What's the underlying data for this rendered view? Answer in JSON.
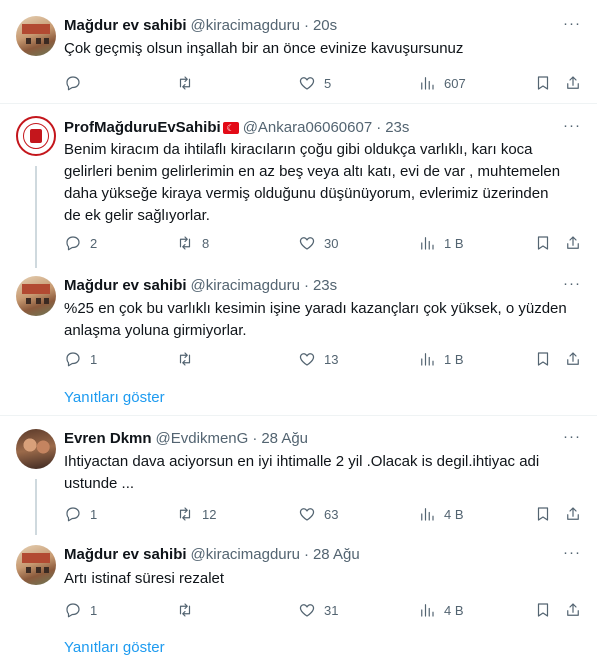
{
  "tweets": [
    {
      "name": "Mağdur ev sahibi",
      "handle": "@kiracimagduru",
      "time": "20s",
      "text": "Çok geçmiş olsun inşallah bir an önce evinize kavuşursunuz",
      "replies": "",
      "retweets": "",
      "likes": "5",
      "views": "607",
      "avatar": "house-avatar"
    },
    {
      "name": "ProfMağduruEvSahibi",
      "flag": "🇹🇷",
      "handle": "@Ankara06060607",
      "time": "23s",
      "text": "Benim kiracım da ihtilaflı kiracıların çoğu gibi oldukça varlıklı, karı koca gelirleri benim gelirlerimin en az beş veya altı katı, evi de var , muhtemelen daha yükseğe kiraya vermiş olduğunu düşünüyorum, evlerimiz üzerinden de ek gelir sağlıyorlar.",
      "replies": "2",
      "retweets": "8",
      "likes": "30",
      "views": "1 B",
      "avatar": "seal-avatar"
    },
    {
      "name": "Mağdur ev sahibi",
      "handle": "@kiracimagduru",
      "time": "23s",
      "text": "%25 en çok bu varlıklı kesimin işine yaradı kazançları çok yüksek, o yüzden anlaşma yoluna girmiyorlar.",
      "replies": "1",
      "retweets": "",
      "likes": "13",
      "views": "1 B",
      "avatar": "house-avatar"
    },
    {
      "name": "Evren Dkmn",
      "handle": "@EvdikmenG",
      "time": "28 Ağu",
      "text": "Ihtiyactan dava aciyorsun  en iyi ihtimalle 2 yil .Olacak is degil.ihtiyac adi ustunde ...",
      "replies": "1",
      "retweets": "12",
      "likes": "63",
      "views": "4 B",
      "avatar": "people-avatar"
    },
    {
      "name": "Mağdur ev sahibi",
      "handle": "@kiracimagduru",
      "time": "28 Ağu",
      "text": "Artı istinaf süresi rezalet",
      "replies": "1",
      "retweets": "",
      "likes": "31",
      "views": "4 B",
      "avatar": "house-avatar"
    }
  ],
  "show_replies_label": "Yanıtları göster",
  "more_label": "···",
  "dot": "·",
  "colors": {
    "link": "#1d9bf0",
    "muted": "#536471",
    "border": "#eff3f4"
  }
}
